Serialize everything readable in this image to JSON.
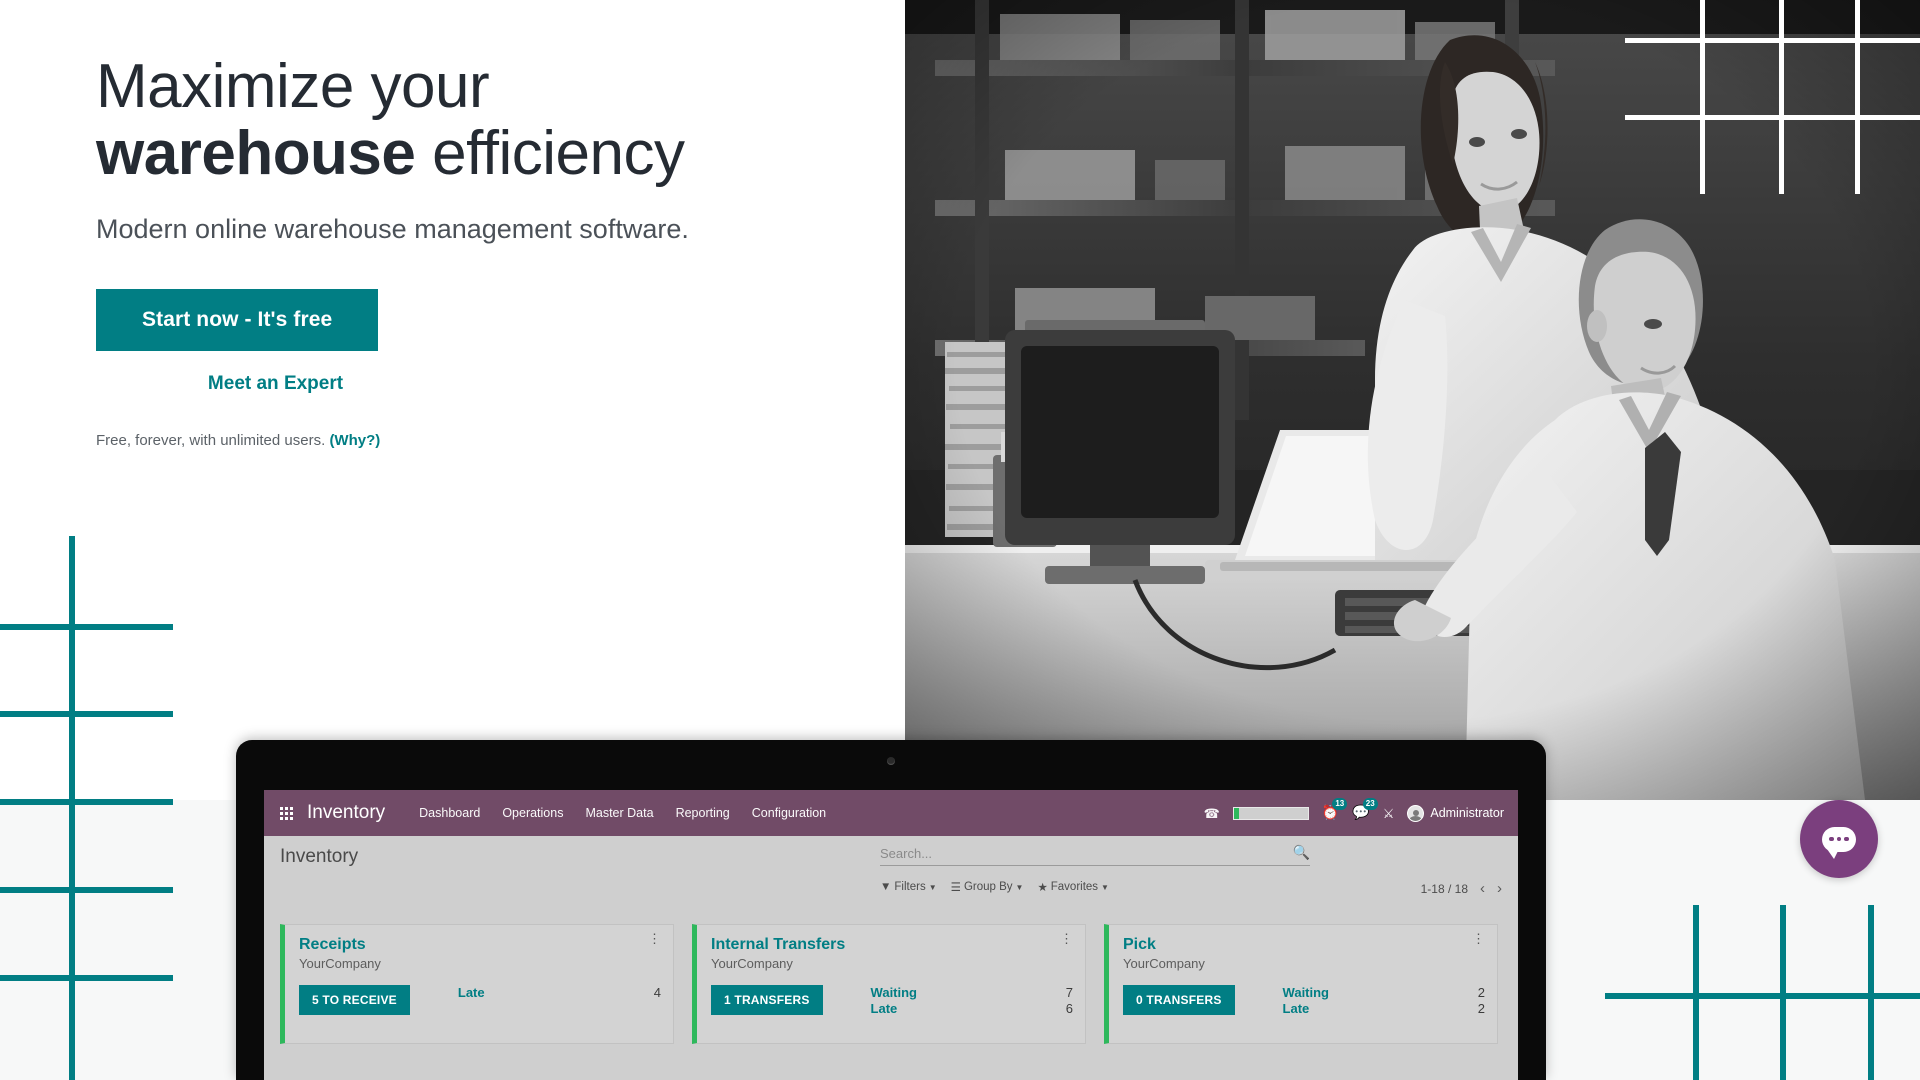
{
  "hero": {
    "title_line1": "Maximize your",
    "title_bold": "warehouse",
    "title_line2_rest": " efficiency",
    "subtitle": "Modern online warehouse management software.",
    "cta_primary": "Start now - It's free",
    "cta_secondary": "Meet an Expert",
    "free_note": "Free, forever, with unlimited users. ",
    "free_note_link": "(Why?)"
  },
  "colors": {
    "teal": "#017E84",
    "odoo_purple": "#714B67",
    "chat_purple": "#7B3F7E",
    "kanban_green": "#2EB85C",
    "heading": "#252B33"
  },
  "app": {
    "navbar": {
      "apps_icon": "apps-grid-icon",
      "app_name": "Inventory",
      "menu": [
        {
          "label": "Dashboard"
        },
        {
          "label": "Operations"
        },
        {
          "label": "Master Data"
        },
        {
          "label": "Reporting"
        },
        {
          "label": "Configuration"
        }
      ],
      "phone_icon": "phone-icon",
      "activity_icon": "clock-icon",
      "activity_count": "13",
      "messages_icon": "chat-icon",
      "messages_count": "23",
      "debug_icon": "bug-icon",
      "user_name": "Administrator",
      "avatar_icon": "avatar-icon"
    },
    "control_panel": {
      "breadcrumb": "Inventory",
      "search_placeholder": "Search...",
      "search_value": "",
      "search_icon": "search-icon",
      "filters_label": "Filters",
      "filters_icon": "funnel-icon",
      "groupby_label": "Group By",
      "groupby_icon": "list-icon",
      "favorites_label": "Favorites",
      "favorites_icon": "star-icon",
      "pager_text": "1-18 / 18",
      "prev_icon": "chevron-left-icon",
      "next_icon": "chevron-right-icon"
    },
    "kanban_cards": [
      {
        "title": "Receipts",
        "company": "YourCompany",
        "button": "5 TO RECEIVE",
        "menu_icon": "kebab-menu-icon",
        "stats": [
          {
            "label": "Late",
            "value": "4"
          }
        ]
      },
      {
        "title": "Internal Transfers",
        "company": "YourCompany",
        "button": "1 TRANSFERS",
        "menu_icon": "kebab-menu-icon",
        "stats": [
          {
            "label": "Waiting",
            "value": "7"
          },
          {
            "label": "Late",
            "value": "6"
          }
        ]
      },
      {
        "title": "Pick",
        "company": "YourCompany",
        "button": "0 TRANSFERS",
        "menu_icon": "kebab-menu-icon",
        "stats": [
          {
            "label": "Waiting",
            "value": "2"
          },
          {
            "label": "Late",
            "value": "2"
          }
        ]
      }
    ]
  },
  "chat_widget": {
    "icon": "chat-bubble-icon"
  }
}
